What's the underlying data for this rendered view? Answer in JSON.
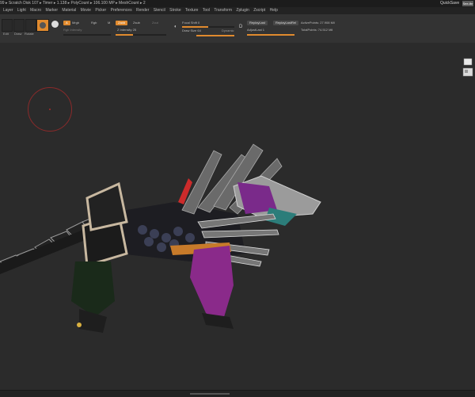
{
  "titlebar": {
    "stats": "99 ▸ Scratch Disk 107 ▸ Timer ▸ 1.138 ▸ PolyCount ▸ 106.100 MP ▸ MeshCount ▸ 2",
    "quicksave": "QuickSave",
    "see_more": "See-thr"
  },
  "menu": [
    "Layer",
    "Light",
    "Macro",
    "Marker",
    "Material",
    "Movie",
    "Picker",
    "Preferences",
    "Render",
    "Stencil",
    "Stroke",
    "Texture",
    "Tool",
    "Transform",
    "Zplugin",
    "Zscript",
    "Help"
  ],
  "toolbar": {
    "edit_label": "Edit",
    "draw_label": "Draw",
    "rotate_label": "Rotate",
    "mrgb": "Mrgb",
    "rgb": "Rgb",
    "m": "M",
    "zadd": "Zadd",
    "zsub": "Zsub",
    "zcut": "Zcut",
    "rgb_intensity": "Rgb Intensity",
    "z_intensity": "Z Intensity 25",
    "a_label": "A",
    "focal_shift": "Focal Shift 0",
    "draw_size": "Draw Size 64",
    "dynamic": "Dynamic",
    "d_label": "D",
    "replay_last": "ReplayLast",
    "replay_last_rel": "ReplayLastRel",
    "adjust_last": "AdjustLast 1",
    "active_points": "ActivePoints: 27.908 Mil",
    "total_points": "TotalPoints: 74.512 Mil"
  },
  "colors": {
    "accent": "#e08a2e",
    "canvas": "#2b2b2b",
    "brush_ring": "#8a2a2a"
  },
  "icons": {
    "navcube": "navigation-cube-icon",
    "brush": "brush-cursor-icon"
  }
}
